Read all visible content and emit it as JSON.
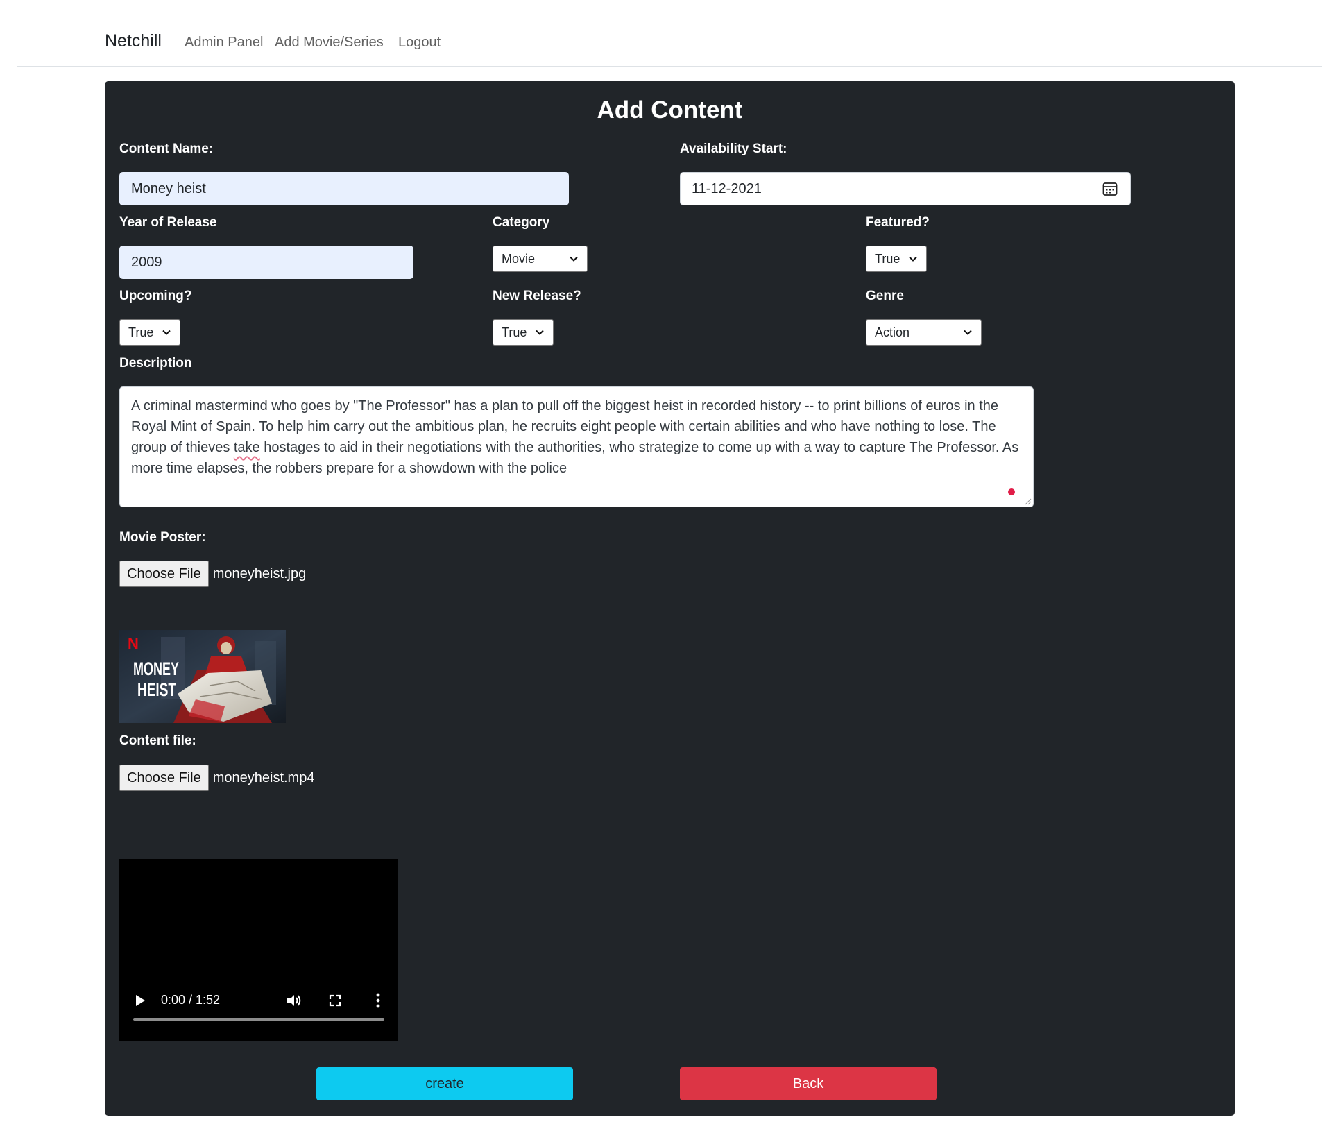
{
  "nav": {
    "brand": "Netchill",
    "links": [
      "Admin Panel",
      "Add Movie/Series",
      "Logout"
    ]
  },
  "form": {
    "title": "Add Content",
    "content_name": {
      "label": "Content Name:",
      "value": "Money heist"
    },
    "availability_start": {
      "label": "Availability Start:",
      "value": "11-12-2021",
      "icon": "calendar-icon"
    },
    "year_of_release": {
      "label": "Year of Release",
      "value": "2009"
    },
    "category": {
      "label": "Category",
      "selected": "Movie"
    },
    "featured": {
      "label": "Featured?",
      "selected": "True"
    },
    "upcoming": {
      "label": "Upcoming?",
      "selected": "True"
    },
    "new_release": {
      "label": "New Release?",
      "selected": "True"
    },
    "genre": {
      "label": "Genre",
      "selected": "Action"
    },
    "description": {
      "label": "Description",
      "text_before": "A criminal mastermind who goes by \"The Professor\" has a plan to pull off the biggest heist in recorded history -- to print billions of euros in the Royal Mint of Spain. To help him carry out the ambitious plan, he recruits eight people with certain abilities and who have nothing to lose. The group of thieves ",
      "text_flagged": "take",
      "text_after": " hostages to aid in their negotiations with the authorities, who strategize to come up with a way to capture The Professor. As more time elapses, the robbers prepare for a showdown with the police"
    },
    "movie_poster": {
      "label": "Movie Poster:",
      "button": "Choose File",
      "filename": "moneyheist.jpg",
      "preview_text_line1": "MONEY",
      "preview_text_line2": "HEIST",
      "preview_logo": "N"
    },
    "content_file": {
      "label": "Content file:",
      "button": "Choose File",
      "filename": "moneyheist.mp4"
    },
    "video": {
      "time": "0:00 / 1:52",
      "progress": 0
    },
    "buttons": {
      "create": "create",
      "back": "Back"
    }
  },
  "colors": {
    "card_bg": "#212529",
    "create": "#0dcaf0",
    "back": "#dc3545",
    "autofill": "#e8f0fe"
  }
}
